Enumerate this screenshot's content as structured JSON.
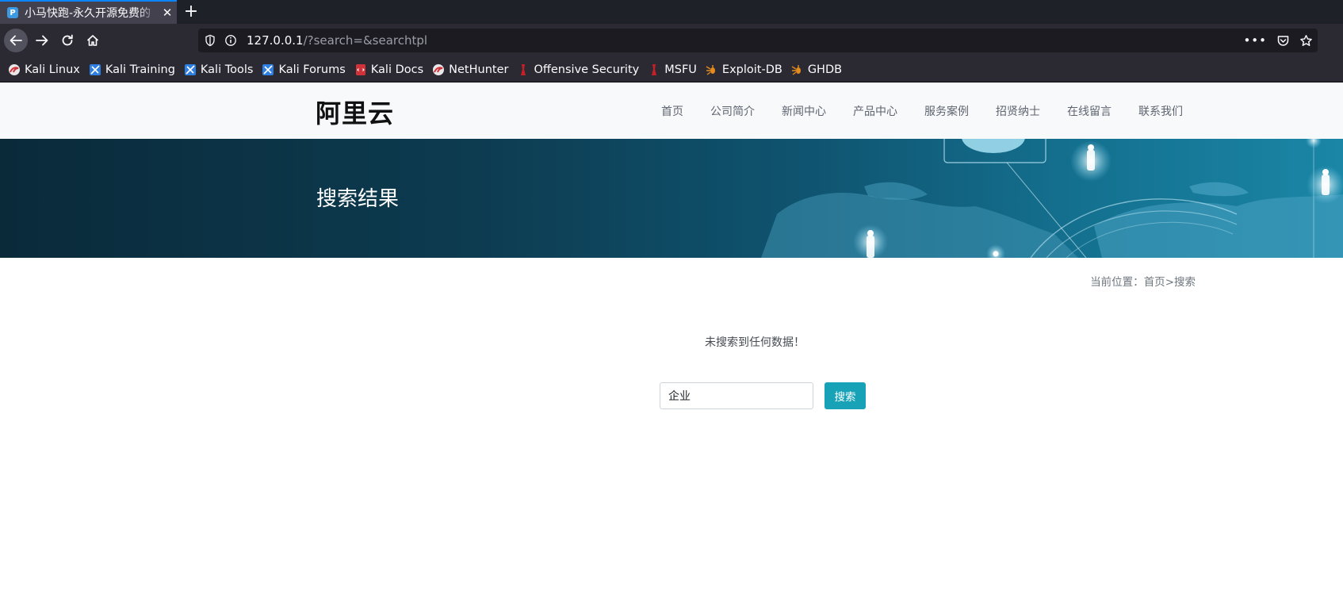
{
  "browser": {
    "tab": {
      "title": "小马快跑-永久开源免费的",
      "favicon_icon": "pbootcms-favicon-icon"
    },
    "url": {
      "host": "127.0.0.1",
      "path": "/?search=&searchtpl"
    },
    "bookmarks": [
      {
        "label": "Kali Linux",
        "icon": "kali-dragon-icon"
      },
      {
        "label": "Kali Training",
        "icon": "kali-training-icon"
      },
      {
        "label": "Kali Tools",
        "icon": "kali-tools-icon"
      },
      {
        "label": "Kali Forums",
        "icon": "kali-forums-icon"
      },
      {
        "label": "Kali Docs",
        "icon": "kali-docs-icon"
      },
      {
        "label": "NetHunter",
        "icon": "kali-dragon-icon"
      },
      {
        "label": "Offensive Security",
        "icon": "offsec-icon"
      },
      {
        "label": "MSFU",
        "icon": "offsec-icon"
      },
      {
        "label": "Exploit-DB",
        "icon": "exploitdb-icon"
      },
      {
        "label": "GHDB",
        "icon": "exploitdb-icon"
      }
    ]
  },
  "site": {
    "logo": "阿里云",
    "nav": [
      "首页",
      "公司简介",
      "新闻中心",
      "产品中心",
      "服务案例",
      "招贤纳士",
      "在线留言",
      "联系我们"
    ],
    "hero_title": "搜索结果",
    "breadcrumb": {
      "prefix": "当前位置：",
      "home": "首页",
      "sep": ">",
      "current": "搜索"
    },
    "empty_message": "未搜索到任何数据！",
    "search": {
      "value": "企业",
      "button": "搜索"
    }
  },
  "colors": {
    "accent": "#17a2b8",
    "hero_dark": "#0a2a3a",
    "hero_light": "#1b86a6",
    "tab_highlight": "#0a84ff"
  }
}
